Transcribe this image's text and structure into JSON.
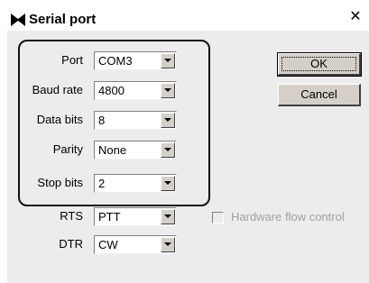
{
  "window": {
    "title": "Serial port",
    "close_glyph": "✕"
  },
  "fields": [
    {
      "label": "Port",
      "value": "COM3"
    },
    {
      "label": "Baud rate",
      "value": "4800"
    },
    {
      "label": "Data bits",
      "value": "8"
    },
    {
      "label": "Parity",
      "value": "None"
    },
    {
      "label": "Stop bits",
      "value": "2"
    },
    {
      "label": "RTS",
      "value": "PTT"
    },
    {
      "label": "DTR",
      "value": "CW"
    }
  ],
  "buttons": {
    "ok": "OK",
    "cancel": "Cancel"
  },
  "hardware_flow_control": {
    "label": "Hardware flow control",
    "checked": false,
    "enabled": false
  },
  "icons": {
    "title": "bowtie-app-icon",
    "dropdown": "chevron-down-icon",
    "close": "close-icon"
  }
}
